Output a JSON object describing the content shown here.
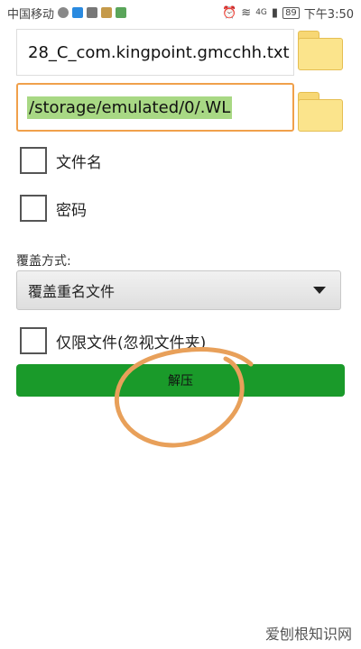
{
  "status": {
    "carrier": "中国移动",
    "battery": "89",
    "time": "下午3:50",
    "network": "4G"
  },
  "form": {
    "file_name": "28_C_com.kingpoint.gmcchh.txt",
    "destination": "/storage/emulated/0/.WL",
    "filename_check": "文件名",
    "password_check": "密码",
    "overwrite_label": "覆盖方式:",
    "overwrite_value": "覆盖重名文件",
    "files_only_check": "仅限文件(忽视文件夹)",
    "extract_button": "解压"
  },
  "watermark": "爱刨根知识网",
  "colors": {
    "accent_orange": "#f0a04b",
    "button_green": "#1a9a2a",
    "highlight_green": "#a8d884"
  }
}
